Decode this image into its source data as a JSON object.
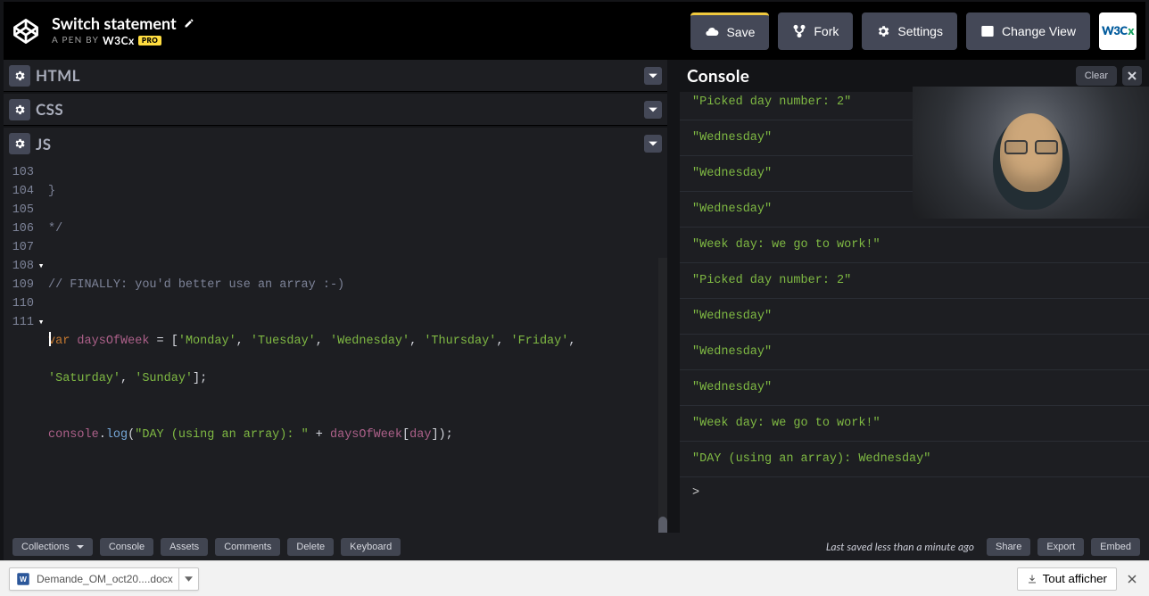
{
  "header": {
    "title": "Switch statement",
    "by_prefix": "A PEN BY",
    "author": "W3Cx",
    "pro_badge": "PRO",
    "buttons": {
      "save": "Save",
      "fork": "Fork",
      "settings": "Settings",
      "change_view": "Change View"
    },
    "avatar_text": "W3C"
  },
  "panes": {
    "html": "HTML",
    "css": "CSS",
    "js": "JS"
  },
  "code": {
    "line_nums": [
      "103",
      "104",
      "105",
      "106",
      "107",
      "108",
      "",
      "109",
      "110",
      "111"
    ],
    "l103": "}",
    "l104": "*/",
    "l105": "",
    "l106": "// FINALLY: you'd better use an array :-)",
    "l107": "",
    "var_kw": "var",
    "days_ident": "daysOfWeek",
    "eq": " = ",
    "arr_open": "[",
    "d0": "'Monday'",
    "c0": ", ",
    "d1": "'Tuesday'",
    "c1": ", ",
    "d2": "'Wednesday'",
    "c2": ", ",
    "d3": "'Thursday'",
    "c3": ", ",
    "d4": "'Friday'",
    "c4": ", ",
    "d5": "'Saturday'",
    "c5": ", ",
    "d6": "'Sunday'",
    "arr_close": "];",
    "l109": "",
    "console_obj": "console",
    "dot": ".",
    "log_method": "log",
    "log_open": "(",
    "log_str": "\"DAY (using an array): \"",
    "plus": " + ",
    "arr_ident": "daysOfWeek",
    "idx_open": "[",
    "day_ident": "day",
    "idx_close": "]",
    "log_close": ");",
    "l111": ""
  },
  "console": {
    "title": "Console",
    "clear": "Clear",
    "lines": [
      "\"Picked day number: 2\"",
      "\"Wednesday\"",
      "\"Wednesday\"",
      "\"Wednesday\"",
      "\"Week day: we go to work!\"",
      "\"Picked day number: 2\"",
      "\"Wednesday\"",
      "\"Wednesday\"",
      "\"Wednesday\"",
      "\"Week day: we go to work!\"",
      "\"DAY (using an array): Wednesday\""
    ]
  },
  "footer": {
    "collections": "Collections",
    "console": "Console",
    "assets": "Assets",
    "comments": "Comments",
    "delete": "Delete",
    "keyboard": "Keyboard",
    "status": "Last saved less than a minute ago",
    "share": "Share",
    "export": "Export",
    "embed": "Embed"
  },
  "taskbar": {
    "download": "Demande_OM_oct20....docx",
    "show_all": "Tout afficher"
  }
}
